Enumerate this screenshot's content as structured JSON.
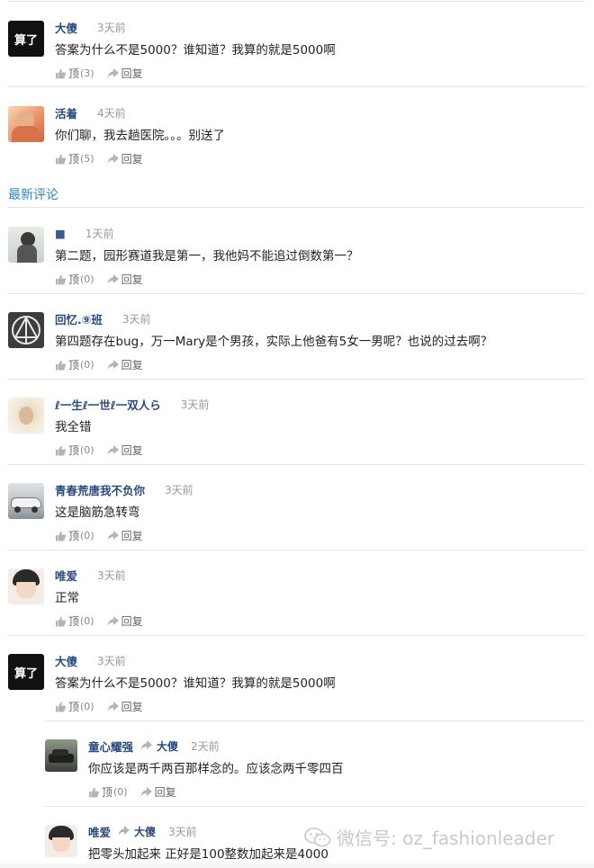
{
  "actions": {
    "up_label": "顶",
    "reply_label": "回复"
  },
  "section_title": "最新评论",
  "hot_comments": [
    {
      "author": "大傻",
      "time": "3天前",
      "text": "答案为什么不是5000？谁知道？我算的就是5000啊",
      "up_count": "(3)",
      "avatar_text": "算了"
    },
    {
      "author": "活着",
      "time": "4天前",
      "text": "你们聊，我去趟医院。。。别送了",
      "up_count": "(5)"
    }
  ],
  "latest_comments": [
    {
      "author": "■",
      "time": "1天前",
      "text": "第二题，园形赛道我是第一，我他妈不能追过倒数第一？",
      "up_count": "(0)"
    },
    {
      "author": "回忆.⑨班",
      "time": "3天前",
      "text": "第四题存在bug，万一Mary是个男孩，实际上他爸有5女一男呢？也说的过去啊？",
      "up_count": "(0)"
    },
    {
      "author": "ℓ一生ℓ一世ℓ一双人ら",
      "time": "3天前",
      "text": "我全错",
      "up_count": "(0)"
    },
    {
      "author": "青春荒唐我不负你",
      "time": "3天前",
      "text": "这是脑筋急转弯",
      "up_count": "(0)"
    },
    {
      "author": "唯爱",
      "time": "3天前",
      "text": "正常",
      "up_count": "(0)"
    },
    {
      "author": "大傻",
      "time": "3天前",
      "text": "答案为什么不是5000？谁知道？我算的就是5000啊",
      "up_count": "(0)",
      "avatar_text": "算了"
    }
  ],
  "replies": [
    {
      "author": "童心耀强",
      "reply_to": "大傻",
      "time": "2天前",
      "text": "你应该是两千两百那样念的。应该念两千零四百",
      "up_count": "(0)"
    },
    {
      "author": "唯爱",
      "reply_to": "大傻",
      "time": "3天前",
      "text": "把零头加起来 正好是100整数加起来是4000"
    }
  ],
  "watermark": "微信号: oz_fashionleader"
}
